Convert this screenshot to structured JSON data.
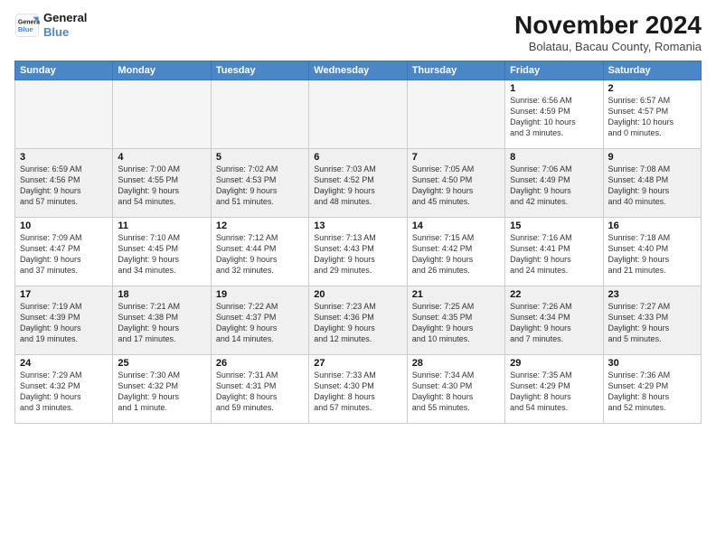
{
  "header": {
    "logo_line1": "General",
    "logo_line2": "Blue",
    "month_title": "November 2024",
    "subtitle": "Bolatau, Bacau County, Romania"
  },
  "days_of_week": [
    "Sunday",
    "Monday",
    "Tuesday",
    "Wednesday",
    "Thursday",
    "Friday",
    "Saturday"
  ],
  "weeks": [
    [
      {
        "day": "",
        "info": "",
        "empty": true
      },
      {
        "day": "",
        "info": "",
        "empty": true
      },
      {
        "day": "",
        "info": "",
        "empty": true
      },
      {
        "day": "",
        "info": "",
        "empty": true
      },
      {
        "day": "",
        "info": "",
        "empty": true
      },
      {
        "day": "1",
        "info": "Sunrise: 6:56 AM\nSunset: 4:59 PM\nDaylight: 10 hours\nand 3 minutes."
      },
      {
        "day": "2",
        "info": "Sunrise: 6:57 AM\nSunset: 4:57 PM\nDaylight: 10 hours\nand 0 minutes."
      }
    ],
    [
      {
        "day": "3",
        "info": "Sunrise: 6:59 AM\nSunset: 4:56 PM\nDaylight: 9 hours\nand 57 minutes."
      },
      {
        "day": "4",
        "info": "Sunrise: 7:00 AM\nSunset: 4:55 PM\nDaylight: 9 hours\nand 54 minutes."
      },
      {
        "day": "5",
        "info": "Sunrise: 7:02 AM\nSunset: 4:53 PM\nDaylight: 9 hours\nand 51 minutes."
      },
      {
        "day": "6",
        "info": "Sunrise: 7:03 AM\nSunset: 4:52 PM\nDaylight: 9 hours\nand 48 minutes."
      },
      {
        "day": "7",
        "info": "Sunrise: 7:05 AM\nSunset: 4:50 PM\nDaylight: 9 hours\nand 45 minutes."
      },
      {
        "day": "8",
        "info": "Sunrise: 7:06 AM\nSunset: 4:49 PM\nDaylight: 9 hours\nand 42 minutes."
      },
      {
        "day": "9",
        "info": "Sunrise: 7:08 AM\nSunset: 4:48 PM\nDaylight: 9 hours\nand 40 minutes."
      }
    ],
    [
      {
        "day": "10",
        "info": "Sunrise: 7:09 AM\nSunset: 4:47 PM\nDaylight: 9 hours\nand 37 minutes."
      },
      {
        "day": "11",
        "info": "Sunrise: 7:10 AM\nSunset: 4:45 PM\nDaylight: 9 hours\nand 34 minutes."
      },
      {
        "day": "12",
        "info": "Sunrise: 7:12 AM\nSunset: 4:44 PM\nDaylight: 9 hours\nand 32 minutes."
      },
      {
        "day": "13",
        "info": "Sunrise: 7:13 AM\nSunset: 4:43 PM\nDaylight: 9 hours\nand 29 minutes."
      },
      {
        "day": "14",
        "info": "Sunrise: 7:15 AM\nSunset: 4:42 PM\nDaylight: 9 hours\nand 26 minutes."
      },
      {
        "day": "15",
        "info": "Sunrise: 7:16 AM\nSunset: 4:41 PM\nDaylight: 9 hours\nand 24 minutes."
      },
      {
        "day": "16",
        "info": "Sunrise: 7:18 AM\nSunset: 4:40 PM\nDaylight: 9 hours\nand 21 minutes."
      }
    ],
    [
      {
        "day": "17",
        "info": "Sunrise: 7:19 AM\nSunset: 4:39 PM\nDaylight: 9 hours\nand 19 minutes."
      },
      {
        "day": "18",
        "info": "Sunrise: 7:21 AM\nSunset: 4:38 PM\nDaylight: 9 hours\nand 17 minutes."
      },
      {
        "day": "19",
        "info": "Sunrise: 7:22 AM\nSunset: 4:37 PM\nDaylight: 9 hours\nand 14 minutes."
      },
      {
        "day": "20",
        "info": "Sunrise: 7:23 AM\nSunset: 4:36 PM\nDaylight: 9 hours\nand 12 minutes."
      },
      {
        "day": "21",
        "info": "Sunrise: 7:25 AM\nSunset: 4:35 PM\nDaylight: 9 hours\nand 10 minutes."
      },
      {
        "day": "22",
        "info": "Sunrise: 7:26 AM\nSunset: 4:34 PM\nDaylight: 9 hours\nand 7 minutes."
      },
      {
        "day": "23",
        "info": "Sunrise: 7:27 AM\nSunset: 4:33 PM\nDaylight: 9 hours\nand 5 minutes."
      }
    ],
    [
      {
        "day": "24",
        "info": "Sunrise: 7:29 AM\nSunset: 4:32 PM\nDaylight: 9 hours\nand 3 minutes."
      },
      {
        "day": "25",
        "info": "Sunrise: 7:30 AM\nSunset: 4:32 PM\nDaylight: 9 hours\nand 1 minute."
      },
      {
        "day": "26",
        "info": "Sunrise: 7:31 AM\nSunset: 4:31 PM\nDaylight: 8 hours\nand 59 minutes."
      },
      {
        "day": "27",
        "info": "Sunrise: 7:33 AM\nSunset: 4:30 PM\nDaylight: 8 hours\nand 57 minutes."
      },
      {
        "day": "28",
        "info": "Sunrise: 7:34 AM\nSunset: 4:30 PM\nDaylight: 8 hours\nand 55 minutes."
      },
      {
        "day": "29",
        "info": "Sunrise: 7:35 AM\nSunset: 4:29 PM\nDaylight: 8 hours\nand 54 minutes."
      },
      {
        "day": "30",
        "info": "Sunrise: 7:36 AM\nSunset: 4:29 PM\nDaylight: 8 hours\nand 52 minutes."
      }
    ]
  ]
}
